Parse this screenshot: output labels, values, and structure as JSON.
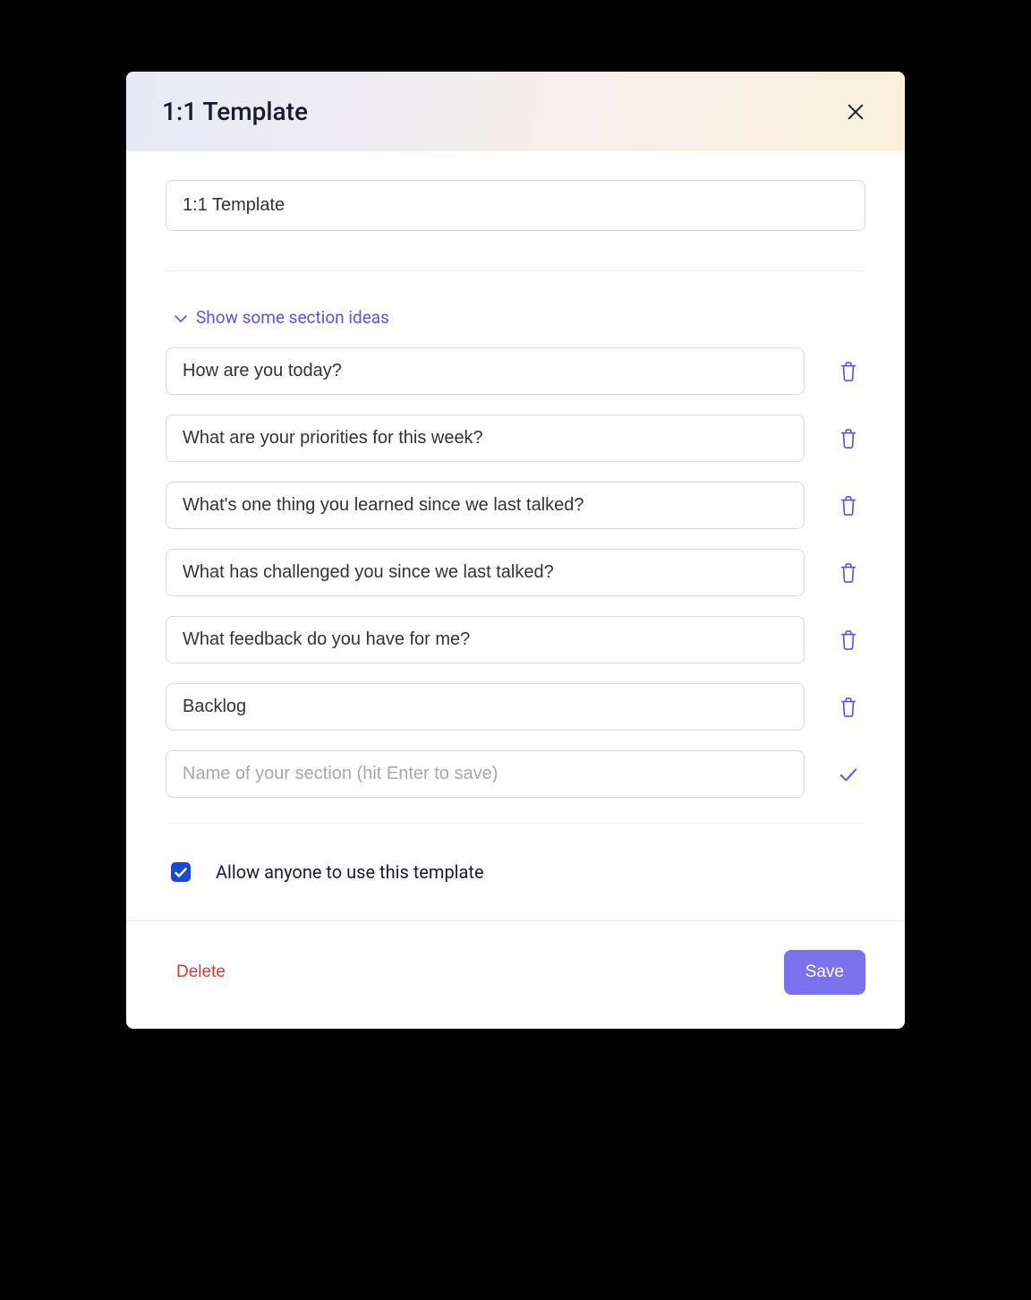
{
  "header": {
    "title": "1:1 Template"
  },
  "template_name": "1:1 Template",
  "section_ideas_label": "Show some section ideas",
  "sections": [
    {
      "value": "How are you today?"
    },
    {
      "value": "What are your priorities for this week?"
    },
    {
      "value": "What's one thing you learned since we last talked?"
    },
    {
      "value": "What has challenged you since we last talked?"
    },
    {
      "value": "What feedback do you have for me?"
    },
    {
      "value": "Backlog"
    }
  ],
  "new_section_placeholder": "Name of your section (hit Enter to save)",
  "allow_anyone": {
    "checked": true,
    "label": "Allow anyone to use this template"
  },
  "footer": {
    "delete_label": "Delete",
    "save_label": "Save"
  },
  "colors": {
    "accent": "#5b52e5",
    "primary_button": "#7a72ec",
    "danger": "#d73a3a",
    "checkbox": "#1649d6"
  }
}
